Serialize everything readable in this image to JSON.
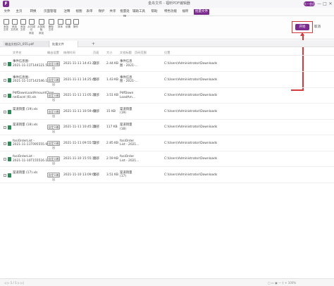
{
  "titlebar": {
    "logo": "F",
    "title": "金舟文件 - 福昕PDF编辑器",
    "user_badge": "大一会员",
    "controls": [
      "—",
      "□",
      "✕"
    ]
  },
  "menu": [
    {
      "label": "文件"
    },
    {
      "label": "主页"
    },
    {
      "label": "转换"
    },
    {
      "label": "页面管理"
    },
    {
      "label": "注释"
    },
    {
      "label": "视图"
    },
    {
      "label": "表单"
    },
    {
      "label": "保护"
    },
    {
      "label": "共享"
    },
    {
      "label": "批量处理"
    },
    {
      "label": "辅助工具"
    },
    {
      "label": "帮助"
    },
    {
      "label": "特色功能"
    },
    {
      "label": "福昕"
    },
    {
      "label": "批量文件"
    }
  ],
  "toolbar": {
    "tools": [
      {
        "label": "添加\n文件",
        "icon": "add-file-icon"
      },
      {
        "label": "添加\n文件夹",
        "icon": "add-folder-icon"
      },
      {
        "label": "添加\n文件",
        "icon": "doc-icon"
      },
      {
        "label": "从扫描仪\n添加",
        "icon": "scanner-icon"
      },
      {
        "label": "从剪贴板\n添加",
        "icon": "clipboard-icon"
      },
      {
        "label": "删除\n文件",
        "icon": "delete-icon"
      },
      {
        "label": "排序",
        "icon": "sort-icon"
      },
      {
        "label": "设置",
        "icon": "settings-icon"
      },
      {
        "label": "操作",
        "icon": "action-icon"
      }
    ],
    "run_label": "开始",
    "second_label": "取消"
  },
  "doc_tabs": [
    "输出文档(2)_055.pdf",
    "批量文件"
  ],
  "doc_tab_add": "+",
  "table": {
    "headers": [
      "文件名",
      "输出设置",
      "修改时间",
      "页面",
      "大小",
      "文档标题",
      "页码范围",
      "位置"
    ],
    "rows": [
      {
        "name": "事件信息图-\n2021-11-11T144121.560...",
        "btn": "自定义输出",
        "modified": "2021-11-11 14:41:22",
        "pages": "全部",
        "size": "2.44 KB",
        "title": "事件信息\n图 - 2021-...",
        "path": "C:\\Users\\Administrator\\Downloads"
      },
      {
        "name": "事件信息图-\n2021-11-11T142546.17...",
        "btn": "自定义输出",
        "modified": "2021-11-11 14:25:46",
        "pages": "全部",
        "size": "1.43 KB",
        "title": "事件信息\n图 - 2021-...",
        "path": "C:\\Users\\Administrator\\Downloads"
      },
      {
        "name": "PdfDownLoadAmountChan\nnelExcel (6).xls",
        "btn": "自定义输出",
        "modified": "2021-11-11 11:05:34",
        "pages": "全部",
        "size": "3.51 KB",
        "title": "PdfDown\nLoadAm...",
        "path": "C:\\Users\\Administrator\\Downloads"
      },
      {
        "name": "渠道销量 (19).xls",
        "btn": "自定义输出",
        "modified": "2021-11-11 10:59:48",
        "pages": "全部",
        "size": "15 KB",
        "title": "渠道销量\n(19)",
        "path": "C:\\Users\\Administrator\\Downloads"
      },
      {
        "name": "渠道销量 (18).xls",
        "btn": "自定义输出",
        "modified": "2021-11-11 10:45:28",
        "pages": "全部",
        "size": "117 KB",
        "title": "渠道销量\n(18)",
        "path": "C:\\Users\\Administrator\\Downloads"
      },
      {
        "name": "fosiOrderList -\n2021-11-11T095555.914...",
        "btn": "自定义输出",
        "modified": "2021-11-11 09:55:52",
        "pages": "全部",
        "size": "2.85 KB",
        "title": "fosiOrder\nList - 2021...",
        "path": "C:\\Users\\Administrator\\Downloads"
      },
      {
        "name": "fosiOrderList -\n2021-11-10T155516.15...",
        "btn": "自定义输出",
        "modified": "2021-11-10 15:55:16",
        "pages": "全部",
        "size": "2.59 KB",
        "title": "fosiOrder\nList - 2021...",
        "path": "C:\\Users\\Administrator\\Downloads"
      },
      {
        "name": "渠道销量 (17).xls",
        "btn": "自定义输出",
        "modified": "2021-11-10 13:09:06",
        "pages": "全部",
        "size": "3.51 KB",
        "title": "渠道销量\n(17)",
        "path": "C:\\Users\\Administrator\\Downloads"
      }
    ]
  },
  "statusbar": {
    "left": "◁ ▷ 1 / 1 ▷ ▷|",
    "right": "□ ▭ ▣ — ┼ + 100%"
  },
  "colors": {
    "accent": "#7b2a8e",
    "highlight": "#d83a3a"
  }
}
